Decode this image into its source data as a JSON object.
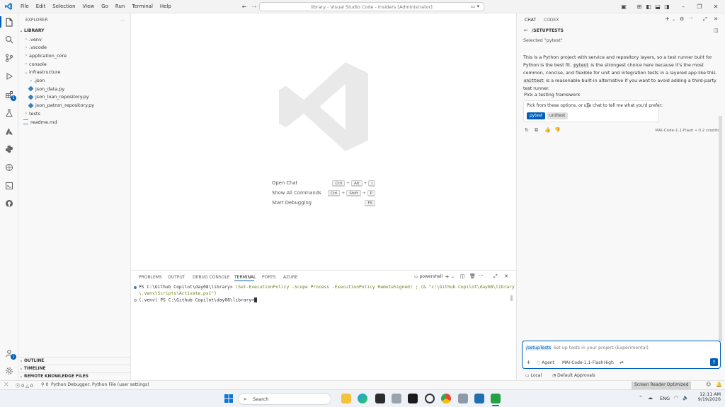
{
  "titlebar": {
    "menus": [
      "File",
      "Edit",
      "Selection",
      "View",
      "Go",
      "Run",
      "Terminal",
      "Help"
    ],
    "command_center": "library - Visual Studio Code - Insiders [Administrator]"
  },
  "sidebar": {
    "title": "EXPLORER",
    "root": "LIBRARY",
    "items": [
      {
        "label": ".venv",
        "kind": "folder",
        "depth": 1
      },
      {
        "label": ".vscode",
        "kind": "folder",
        "depth": 1
      },
      {
        "label": "application_core",
        "kind": "folder",
        "depth": 1
      },
      {
        "label": "console",
        "kind": "folder",
        "depth": 1
      },
      {
        "label": "infrastructure",
        "kind": "folder-open",
        "depth": 1
      },
      {
        "label": ".json",
        "kind": "folder",
        "depth": 2
      },
      {
        "label": "json_data.py",
        "kind": "py",
        "depth": 2
      },
      {
        "label": "json_loan_repository.py",
        "kind": "py",
        "depth": 2
      },
      {
        "label": "json_patron_repository.py",
        "kind": "py",
        "depth": 2
      },
      {
        "label": "tests",
        "kind": "folder",
        "depth": 1
      },
      {
        "label": "readme.md",
        "kind": "md",
        "depth": 1
      }
    ],
    "bottom_sections": [
      "OUTLINE",
      "TIMELINE",
      "REMOTE KNOWLEDGE FILES"
    ]
  },
  "editor": {
    "shortcuts": [
      {
        "label": "Open Chat",
        "keys": [
          "Ctrl",
          "Alt",
          "I"
        ]
      },
      {
        "label": "Show All Commands",
        "keys": [
          "Ctrl",
          "Shift",
          "P"
        ]
      },
      {
        "label": "Start Debugging",
        "keys": [
          "F5"
        ]
      }
    ]
  },
  "panel": {
    "tabs": [
      "PROBLEMS",
      "OUTPUT",
      "DEBUG CONSOLE",
      "TERMINAL",
      "PORTS",
      "AZURE"
    ],
    "active_tab": "TERMINAL",
    "shell": "powershell",
    "terminal": {
      "line1_prompt": "PS C:\\Github Copilot\\day08\\library> ",
      "line1_cmd": "(Set-ExecutionPolicy -Scope Process -ExecutionPolicy RemoteSigned) ; (& \"c:\\Github Copilot\\day08\\library",
      "line2": "\\.venv\\Scripts\\Activate.ps1\")",
      "line3": "(.venv) PS C:\\Github Copilot\\day08\\library>"
    }
  },
  "chat": {
    "tabs": [
      "CHAT",
      "CODEX"
    ],
    "header": "/SETUPTESTS",
    "selected": "Selected \"pytest\"",
    "paragraph": {
      "part1": "This is a Python project with service and repository layers, so a test runner built for Python is the best fit. ",
      "code1": "pytest",
      "part2": " is the strongest choice here because it's the most common, concise, and flexible for unit and integration tests in a layered app like this. ",
      "code2": "unittest",
      "part3": " is a reasonable built-in alternative if you want to avoid adding a third-party test runner."
    },
    "question_title": "Pick a testing framework",
    "question_prompt": "Pick from these options, or use chat to tell me what you'd prefer:",
    "options": [
      "pytest",
      "unittest"
    ],
    "model_credits": "MAI-Code-1.1-Flash • 0.2 credits",
    "input": {
      "command": "/setupTests",
      "hint": "Set up tests in your project (Experimental)",
      "agent": "Agent",
      "model": "MAI-Code-1.1-Flash",
      "effort": "High"
    },
    "footer": {
      "location": "Local",
      "approvals": "Default Approvals"
    }
  },
  "statusbar": {
    "errors": "0",
    "warnings": "0",
    "ports": "0",
    "interpreter": "Python Debugger: Python File (user settings)",
    "screen_reader": "Screen Reader Optimized"
  },
  "taskbar": {
    "search": "Search",
    "lang": "ENG",
    "time": "12:11 AM",
    "date": "9/19/2026"
  },
  "colors": {
    "accent": "#005fb8",
    "python": "#3b7fb6"
  }
}
